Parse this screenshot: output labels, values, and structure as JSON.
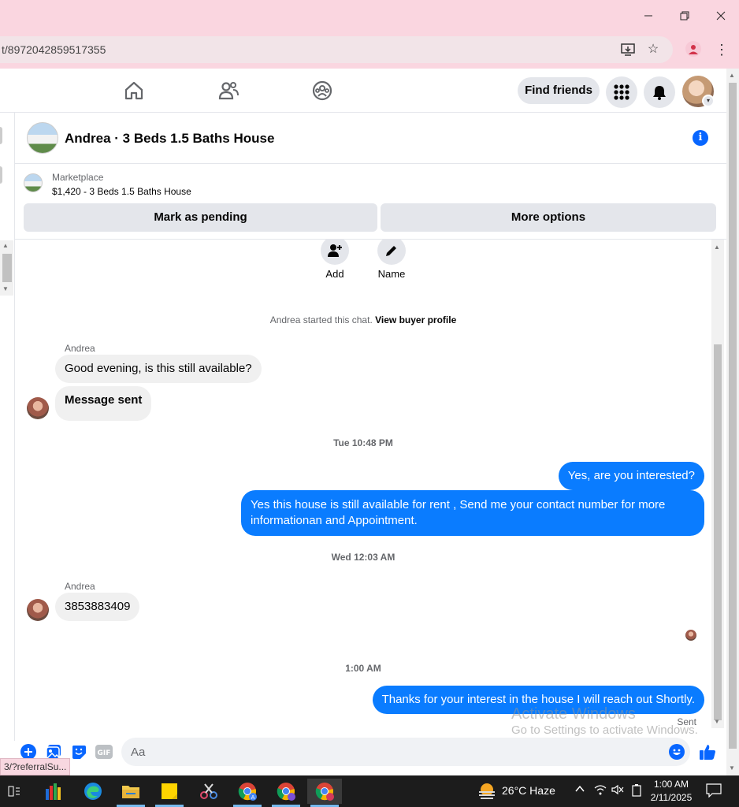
{
  "browser": {
    "url": "t/8972042859517355",
    "status_url": "3/?referralSu..."
  },
  "nav": {
    "find_friends": "Find friends"
  },
  "chat": {
    "title": "Andrea · 3 Beds 1.5 Baths House",
    "info_icon": "info-icon"
  },
  "marketplace": {
    "label": "Marketplace",
    "listing": "$1,420 - 3 Beds 1.5 Baths House",
    "mark_pending": "Mark as pending",
    "more_options": "More options"
  },
  "actions": {
    "add": "Add",
    "name": "Name"
  },
  "messages": {
    "system_prefix": "Andrea started this chat.",
    "system_link": "View buyer profile",
    "sender1": "Andrea",
    "msg1": "Good evening, is this still available?",
    "msg2": "Message sent",
    "ts1": "Tue 10:48 PM",
    "out1": "Yes, are you interested?",
    "out2": "Yes this house is still available for rent , Send me your contact number for more informationan and Appointment.",
    "ts2": "Wed 12:03 AM",
    "sender2": "Andrea",
    "msg3": "3853883409",
    "ts3": "1:00 AM",
    "out3": "Thanks for your interest in the house I will reach out Shortly.",
    "sent": "Sent"
  },
  "watermark": {
    "line1": "Activate Windows",
    "line2": "Go to Settings to activate Windows."
  },
  "composer": {
    "placeholder": "Aa"
  },
  "taskbar": {
    "weather": "26°C  Haze",
    "time": "1:00 AM",
    "date": "2/11/2025"
  },
  "colors": {
    "accent": "#0866ff",
    "bubble_out": "#0a7cff",
    "titlebar": "#fad6e0"
  }
}
